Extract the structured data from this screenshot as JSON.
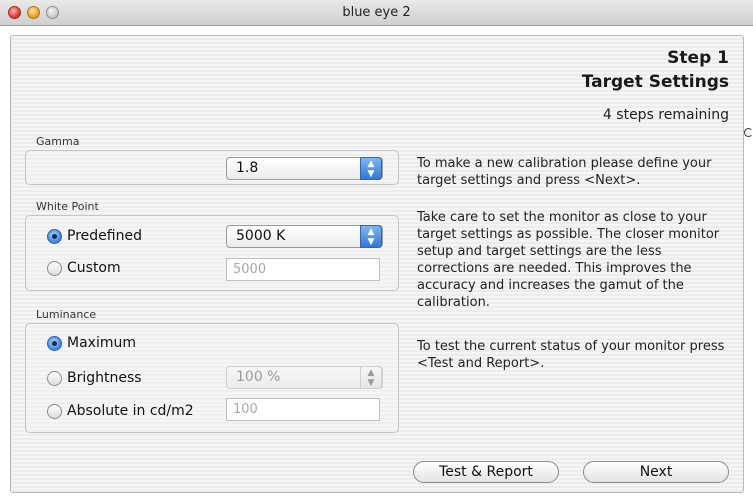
{
  "window": {
    "title": "blue eye 2"
  },
  "header": {
    "step": "Step 1",
    "title": "Target Settings",
    "remaining": "4 steps remaining"
  },
  "gamma": {
    "label": "Gamma",
    "value": "1.8"
  },
  "white_point": {
    "label": "White Point",
    "predefined_label": "Predefined",
    "predefined_value": "5000 K",
    "custom_label": "Custom",
    "custom_value": "5000",
    "selected": "predefined"
  },
  "luminance": {
    "label": "Luminance",
    "maximum_label": "Maximum",
    "brightness_label": "Brightness",
    "brightness_value": "100 %",
    "absolute_label": "Absolute in cd/m2",
    "absolute_value": "100",
    "selected": "maximum"
  },
  "instructions": {
    "p1": "To make a new calibration please define your target settings and press <Next>.",
    "p2": "Take care to set the monitor as close to your target settings as possible. The closer monitor setup and target settings are the less corrections are needed. This improves the accuracy and increases the gamut of the calibration.",
    "p3": "To test the current status of your monitor press <Test and Report>."
  },
  "buttons": {
    "test_report": "Test & Report",
    "next": "Next"
  },
  "colors": {
    "accent": "#3b87e0",
    "window_bg": "#efefef"
  }
}
